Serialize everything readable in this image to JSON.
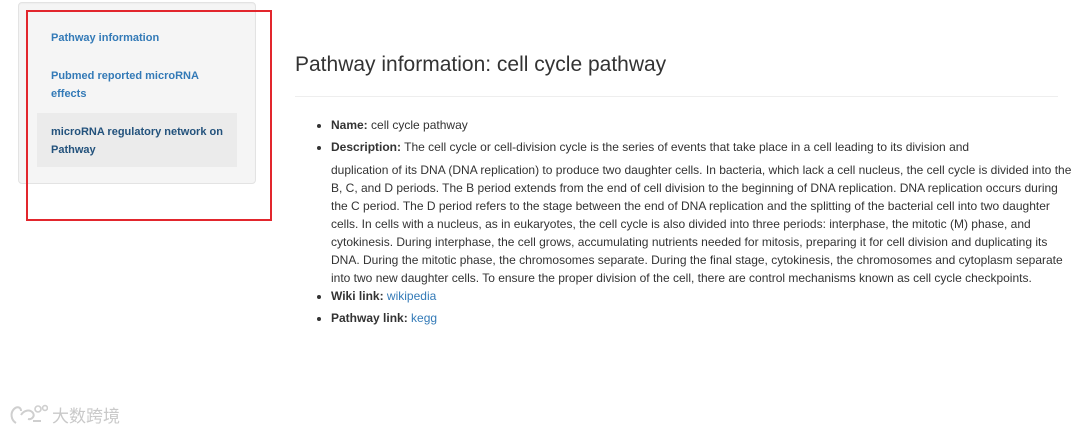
{
  "sidebar": {
    "items": [
      {
        "label": "Pathway information"
      },
      {
        "label": "Pubmed reported microRNA effects"
      },
      {
        "label": "microRNA regulatory network on Pathway"
      }
    ]
  },
  "main": {
    "title": "Pathway information: cell cycle pathway",
    "name": {
      "label": "Name:",
      "value": "cell cycle pathway"
    },
    "description": {
      "label": "Description:",
      "line1": "The cell cycle or cell-division cycle is the series of events that take place in a cell leading to its division and",
      "rest": "duplication of its DNA (DNA replication) to produce two daughter cells. In bacteria, which lack a cell nucleus, the cell cycle is divided into the B, C, and D periods. The B period extends from the end of cell division to the beginning of DNA replication. DNA replication occurs during the C period. The D period refers to the stage between the end of DNA replication and the splitting of the bacterial cell into two daughter cells. In cells with a nucleus, as in eukaryotes, the cell cycle is also divided into three periods: interphase, the mitotic (M) phase, and cytokinesis. During interphase, the cell grows, accumulating nutrients needed for mitosis, preparing it for cell division and duplicating its DNA. During the mitotic phase, the chromosomes separate. During the final stage, cytokinesis, the chromosomes and cytoplasm separate into two new daughter cells. To ensure the proper division of the cell, there are control mechanisms known as cell cycle checkpoints."
    },
    "wiki": {
      "label": "Wiki link:",
      "link_text": "wikipedia"
    },
    "pathway": {
      "label": "Pathway link:",
      "link_text": "kegg"
    }
  },
  "watermark": {
    "text": "大数跨境"
  },
  "colors": {
    "link": "#337ab7",
    "annotation": "#e2262d"
  }
}
